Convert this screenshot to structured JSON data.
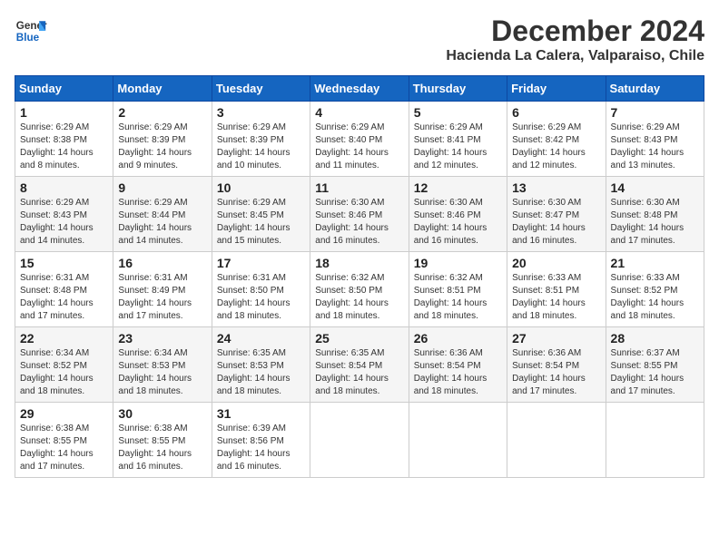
{
  "logo": {
    "line1": "General",
    "line2": "Blue"
  },
  "title": "December 2024",
  "subtitle": "Hacienda La Calera, Valparaiso, Chile",
  "weekdays": [
    "Sunday",
    "Monday",
    "Tuesday",
    "Wednesday",
    "Thursday",
    "Friday",
    "Saturday"
  ],
  "weeks": [
    [
      {
        "day": "1",
        "sunrise": "Sunrise: 6:29 AM",
        "sunset": "Sunset: 8:38 PM",
        "daylight": "Daylight: 14 hours and 8 minutes."
      },
      {
        "day": "2",
        "sunrise": "Sunrise: 6:29 AM",
        "sunset": "Sunset: 8:39 PM",
        "daylight": "Daylight: 14 hours and 9 minutes."
      },
      {
        "day": "3",
        "sunrise": "Sunrise: 6:29 AM",
        "sunset": "Sunset: 8:39 PM",
        "daylight": "Daylight: 14 hours and 10 minutes."
      },
      {
        "day": "4",
        "sunrise": "Sunrise: 6:29 AM",
        "sunset": "Sunset: 8:40 PM",
        "daylight": "Daylight: 14 hours and 11 minutes."
      },
      {
        "day": "5",
        "sunrise": "Sunrise: 6:29 AM",
        "sunset": "Sunset: 8:41 PM",
        "daylight": "Daylight: 14 hours and 12 minutes."
      },
      {
        "day": "6",
        "sunrise": "Sunrise: 6:29 AM",
        "sunset": "Sunset: 8:42 PM",
        "daylight": "Daylight: 14 hours and 12 minutes."
      },
      {
        "day": "7",
        "sunrise": "Sunrise: 6:29 AM",
        "sunset": "Sunset: 8:43 PM",
        "daylight": "Daylight: 14 hours and 13 minutes."
      }
    ],
    [
      {
        "day": "8",
        "sunrise": "Sunrise: 6:29 AM",
        "sunset": "Sunset: 8:43 PM",
        "daylight": "Daylight: 14 hours and 14 minutes."
      },
      {
        "day": "9",
        "sunrise": "Sunrise: 6:29 AM",
        "sunset": "Sunset: 8:44 PM",
        "daylight": "Daylight: 14 hours and 14 minutes."
      },
      {
        "day": "10",
        "sunrise": "Sunrise: 6:29 AM",
        "sunset": "Sunset: 8:45 PM",
        "daylight": "Daylight: 14 hours and 15 minutes."
      },
      {
        "day": "11",
        "sunrise": "Sunrise: 6:30 AM",
        "sunset": "Sunset: 8:46 PM",
        "daylight": "Daylight: 14 hours and 16 minutes."
      },
      {
        "day": "12",
        "sunrise": "Sunrise: 6:30 AM",
        "sunset": "Sunset: 8:46 PM",
        "daylight": "Daylight: 14 hours and 16 minutes."
      },
      {
        "day": "13",
        "sunrise": "Sunrise: 6:30 AM",
        "sunset": "Sunset: 8:47 PM",
        "daylight": "Daylight: 14 hours and 16 minutes."
      },
      {
        "day": "14",
        "sunrise": "Sunrise: 6:30 AM",
        "sunset": "Sunset: 8:48 PM",
        "daylight": "Daylight: 14 hours and 17 minutes."
      }
    ],
    [
      {
        "day": "15",
        "sunrise": "Sunrise: 6:31 AM",
        "sunset": "Sunset: 8:48 PM",
        "daylight": "Daylight: 14 hours and 17 minutes."
      },
      {
        "day": "16",
        "sunrise": "Sunrise: 6:31 AM",
        "sunset": "Sunset: 8:49 PM",
        "daylight": "Daylight: 14 hours and 17 minutes."
      },
      {
        "day": "17",
        "sunrise": "Sunrise: 6:31 AM",
        "sunset": "Sunset: 8:50 PM",
        "daylight": "Daylight: 14 hours and 18 minutes."
      },
      {
        "day": "18",
        "sunrise": "Sunrise: 6:32 AM",
        "sunset": "Sunset: 8:50 PM",
        "daylight": "Daylight: 14 hours and 18 minutes."
      },
      {
        "day": "19",
        "sunrise": "Sunrise: 6:32 AM",
        "sunset": "Sunset: 8:51 PM",
        "daylight": "Daylight: 14 hours and 18 minutes."
      },
      {
        "day": "20",
        "sunrise": "Sunrise: 6:33 AM",
        "sunset": "Sunset: 8:51 PM",
        "daylight": "Daylight: 14 hours and 18 minutes."
      },
      {
        "day": "21",
        "sunrise": "Sunrise: 6:33 AM",
        "sunset": "Sunset: 8:52 PM",
        "daylight": "Daylight: 14 hours and 18 minutes."
      }
    ],
    [
      {
        "day": "22",
        "sunrise": "Sunrise: 6:34 AM",
        "sunset": "Sunset: 8:52 PM",
        "daylight": "Daylight: 14 hours and 18 minutes."
      },
      {
        "day": "23",
        "sunrise": "Sunrise: 6:34 AM",
        "sunset": "Sunset: 8:53 PM",
        "daylight": "Daylight: 14 hours and 18 minutes."
      },
      {
        "day": "24",
        "sunrise": "Sunrise: 6:35 AM",
        "sunset": "Sunset: 8:53 PM",
        "daylight": "Daylight: 14 hours and 18 minutes."
      },
      {
        "day": "25",
        "sunrise": "Sunrise: 6:35 AM",
        "sunset": "Sunset: 8:54 PM",
        "daylight": "Daylight: 14 hours and 18 minutes."
      },
      {
        "day": "26",
        "sunrise": "Sunrise: 6:36 AM",
        "sunset": "Sunset: 8:54 PM",
        "daylight": "Daylight: 14 hours and 18 minutes."
      },
      {
        "day": "27",
        "sunrise": "Sunrise: 6:36 AM",
        "sunset": "Sunset: 8:54 PM",
        "daylight": "Daylight: 14 hours and 17 minutes."
      },
      {
        "day": "28",
        "sunrise": "Sunrise: 6:37 AM",
        "sunset": "Sunset: 8:55 PM",
        "daylight": "Daylight: 14 hours and 17 minutes."
      }
    ],
    [
      {
        "day": "29",
        "sunrise": "Sunrise: 6:38 AM",
        "sunset": "Sunset: 8:55 PM",
        "daylight": "Daylight: 14 hours and 17 minutes."
      },
      {
        "day": "30",
        "sunrise": "Sunrise: 6:38 AM",
        "sunset": "Sunset: 8:55 PM",
        "daylight": "Daylight: 14 hours and 16 minutes."
      },
      {
        "day": "31",
        "sunrise": "Sunrise: 6:39 AM",
        "sunset": "Sunset: 8:56 PM",
        "daylight": "Daylight: 14 hours and 16 minutes."
      },
      null,
      null,
      null,
      null
    ]
  ]
}
